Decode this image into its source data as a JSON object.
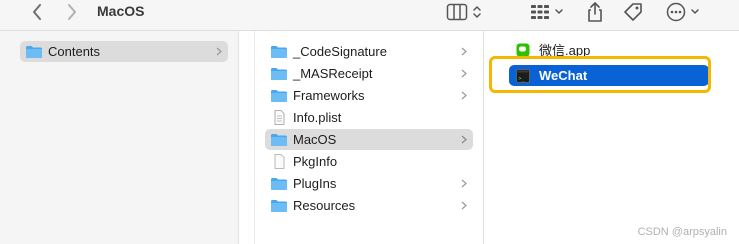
{
  "window": {
    "title": "MacOS"
  },
  "colors": {
    "accent": "#0a63d6",
    "highlight": "#f5b800",
    "folder": "#5ab0f1"
  },
  "toolbar": {
    "back_icon": "chevron-left-icon",
    "forward_icon": "chevron-right-icon",
    "view_icon": "column-view-icon",
    "group_icon": "grid-group-icon",
    "share_icon": "share-icon",
    "tag_icon": "tag-icon",
    "more_icon": "ellipsis-circle-icon"
  },
  "column1": {
    "items": [
      {
        "label": "Contents",
        "icon": "folder-icon",
        "selected": true
      }
    ]
  },
  "column2": {
    "items": [
      {
        "label": "_CodeSignature",
        "icon": "folder-icon"
      },
      {
        "label": "_MASReceipt",
        "icon": "folder-icon"
      },
      {
        "label": "Frameworks",
        "icon": "folder-icon"
      },
      {
        "label": "Info.plist",
        "icon": "plist-file-icon"
      },
      {
        "label": "MacOS",
        "icon": "folder-icon",
        "selected": true
      },
      {
        "label": "PkgInfo",
        "icon": "file-icon"
      },
      {
        "label": "PlugIns",
        "icon": "folder-icon"
      },
      {
        "label": "Resources",
        "icon": "folder-icon"
      }
    ]
  },
  "column3": {
    "items": [
      {
        "label": "微信.app",
        "icon": "app-icon"
      },
      {
        "label": "WeChat",
        "icon": "terminal-exec-icon",
        "selected": true
      }
    ]
  },
  "watermark": "CSDN @arpsyalin"
}
